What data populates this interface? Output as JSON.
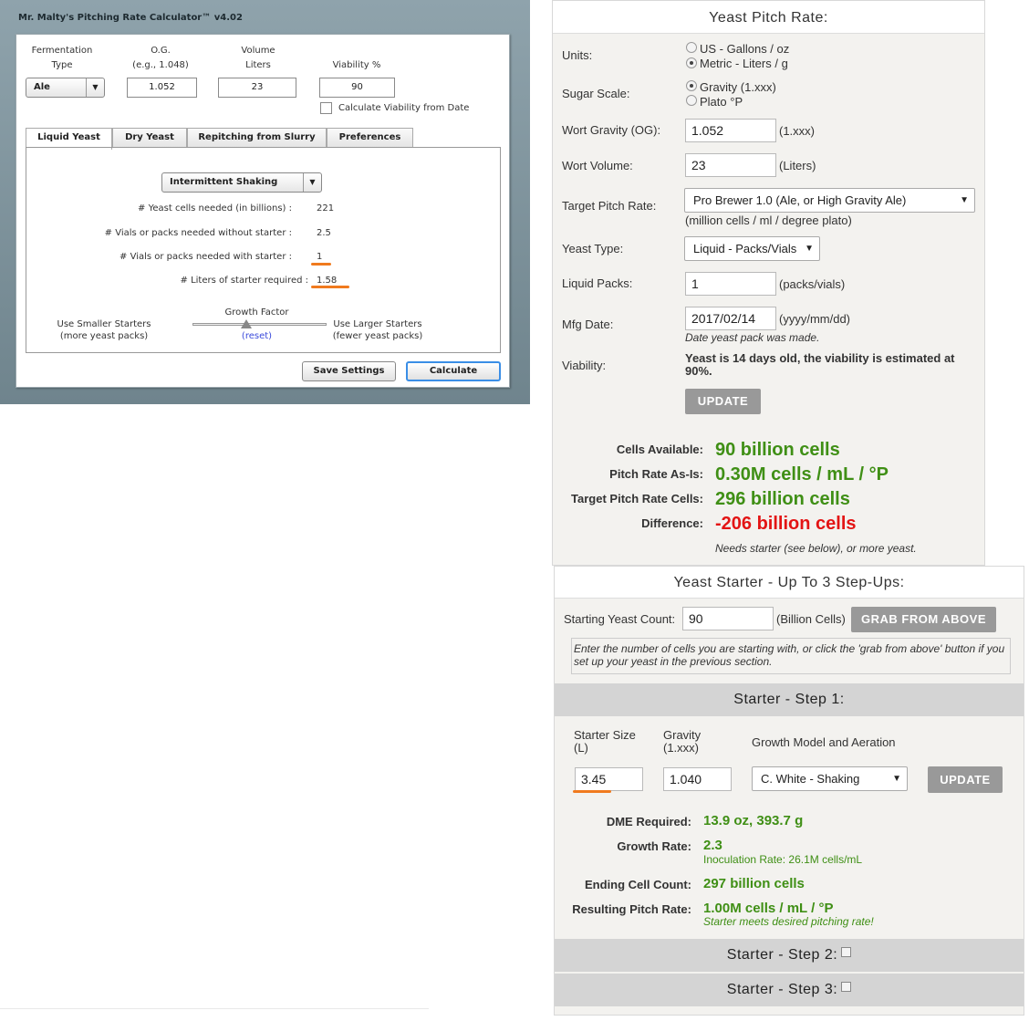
{
  "malty": {
    "title": "Mr. Malty's Pitching Rate Calculator™ v4.02",
    "labels": {
      "fermentation_line1": "Fermentation",
      "fermentation_line2": "Type",
      "og_line1": "O.G.",
      "og_line2": "(e.g., 1.048)",
      "volume_line1": "Volume",
      "volume_line2": "Liters",
      "viability": "Viability %"
    },
    "fermentation_type": "Ale",
    "og": "1.052",
    "volume": "23",
    "viability": "90",
    "calc_viability_label": "Calculate Viability from Date",
    "tabs": [
      {
        "label": "Liquid Yeast"
      },
      {
        "label": "Dry Yeast"
      },
      {
        "label": "Repitching from Slurry"
      },
      {
        "label": "Preferences"
      }
    ],
    "aeration_method": "Intermittent Shaking",
    "rows": [
      {
        "label": "# Yeast cells needed (in billions) :",
        "value": "221"
      },
      {
        "label": "# Vials or packs needed without starter :",
        "value": "2.5"
      },
      {
        "label": "# Vials or packs needed with starter :",
        "value": "1"
      },
      {
        "label": "# Liters of starter required :",
        "value": "1.58"
      }
    ],
    "growth_factor": "Growth Factor",
    "reset": "(reset)",
    "smaller_line1": "Use Smaller Starters",
    "smaller_line2": "(more yeast packs)",
    "larger_line1": "Use Larger Starters",
    "larger_line2": "(fewer yeast packs)",
    "save_settings": "Save Settings",
    "calculate": "Calculate",
    "slider_position": 0.4
  },
  "pitch": {
    "title": "Yeast Pitch Rate:",
    "units_label": "Units:",
    "units_options": [
      "US - Gallons / oz",
      "Metric - Liters / g"
    ],
    "sugar_label": "Sugar Scale:",
    "sugar_options": [
      "Gravity (1.xxx)",
      "Plato °P"
    ],
    "wort_gravity_label": "Wort Gravity (OG):",
    "wort_gravity": "1.052",
    "wort_gravity_unit": "(1.xxx)",
    "wort_volume_label": "Wort Volume:",
    "wort_volume": "23",
    "wort_volume_unit": "(Liters)",
    "target_rate_label": "Target Pitch Rate:",
    "target_rate": "Pro Brewer 1.0 (Ale, or High Gravity Ale)",
    "target_rate_unit": "(million cells / ml / degree plato)",
    "yeast_type_label": "Yeast Type:",
    "yeast_type": "Liquid - Packs/Vials",
    "liquid_packs_label": "Liquid Packs:",
    "liquid_packs": "1",
    "liquid_packs_unit": "(packs/vials)",
    "mfg_date_label": "Mfg Date:",
    "mfg_date": "2017/02/14",
    "mfg_date_unit": "(yyyy/mm/dd)",
    "mfg_date_hint": "Date yeast pack was made.",
    "viability_label": "Viability:",
    "viability_text": "Yeast is 14 days old, the viability is estimated at 90%.",
    "update": "UPDATE",
    "results": [
      {
        "label": "Cells Available:",
        "value": "90 billion cells"
      },
      {
        "label": "Pitch Rate As-Is:",
        "value": "0.30M cells / mL / °P"
      },
      {
        "label": "Target Pitch Rate Cells:",
        "value": "296 billion cells"
      },
      {
        "label": "Difference:",
        "value": "-206 billion cells"
      }
    ],
    "note": "Needs starter (see below), or more yeast."
  },
  "starter": {
    "title": "Yeast Starter - Up To 3 Step-Ups:",
    "starting_count_label": "Starting Yeast Count:",
    "starting_count": "90",
    "starting_count_unit": "(Billion Cells)",
    "grab_button": "GRAB FROM ABOVE",
    "hint": "Enter the number of cells you are starting with, or click the 'grab from above' button if you set up your yeast in the previous section.",
    "step1_title": "Starter - Step 1:",
    "size_label_line1": "Starter Size",
    "size_label_line2": "(L)",
    "gravity_label_line1": "Gravity",
    "gravity_label_line2": "(1.xxx)",
    "model_label": "Growth Model and Aeration",
    "size": "3.45",
    "gravity": "1.040",
    "model": "C. White - Shaking",
    "update": "UPDATE",
    "dme_label": "DME Required:",
    "dme": "13.9 oz, 393.7 g",
    "growth_label": "Growth Rate:",
    "growth": "2.3",
    "inoculation": "Inoculation Rate: 26.1M cells/mL",
    "ending_label": "Ending Cell Count:",
    "ending": "297 billion cells",
    "resulting_label": "Resulting Pitch Rate:",
    "resulting": "1.00M cells / mL / °P",
    "resulting_note": "Starter meets desired pitching rate!",
    "step2_title": "Starter - Step 2:",
    "step3_title": "Starter - Step 3:"
  },
  "colors": {
    "green": "#3f8f15",
    "red": "#e31414",
    "orange_highlight": "#f07a1e",
    "button_gray": "#999999"
  }
}
